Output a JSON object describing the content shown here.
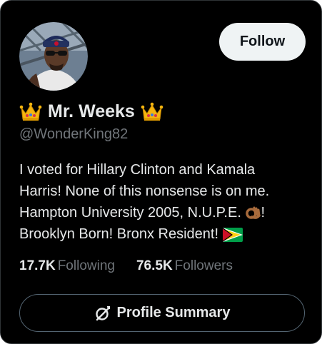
{
  "profile": {
    "display_name": "Mr. Weeks",
    "handle": "@WonderKing82",
    "name_prefix_icon": "crown-emoji",
    "name_suffix_icon": "crown-emoji",
    "avatar_icon": "profile-photo"
  },
  "follow_button": {
    "label": "Follow"
  },
  "bio": {
    "line1": "I voted for Hillary Clinton and Kamala",
    "line2": "Harris! None of this nonsense is on me.",
    "line3a": "Hampton University 2005, N.U.P.E.",
    "line3_icon": "ok-hand-emoji",
    "line3b": "!",
    "line4": "Brooklyn Born! Bronx Resident!",
    "line4_icon": "guyana-flag-emoji"
  },
  "stats": {
    "following_count": "17.7K",
    "following_label": "Following",
    "followers_count": "76.5K",
    "followers_label": "Followers"
  },
  "summary_button": {
    "label": "Profile Summary",
    "icon": "grok-icon"
  },
  "colors": {
    "background": "#000000",
    "primary_text": "#e7e9ea",
    "secondary_text": "#71767b",
    "follow_button_bg": "#eff3f4",
    "border": "#536471"
  }
}
